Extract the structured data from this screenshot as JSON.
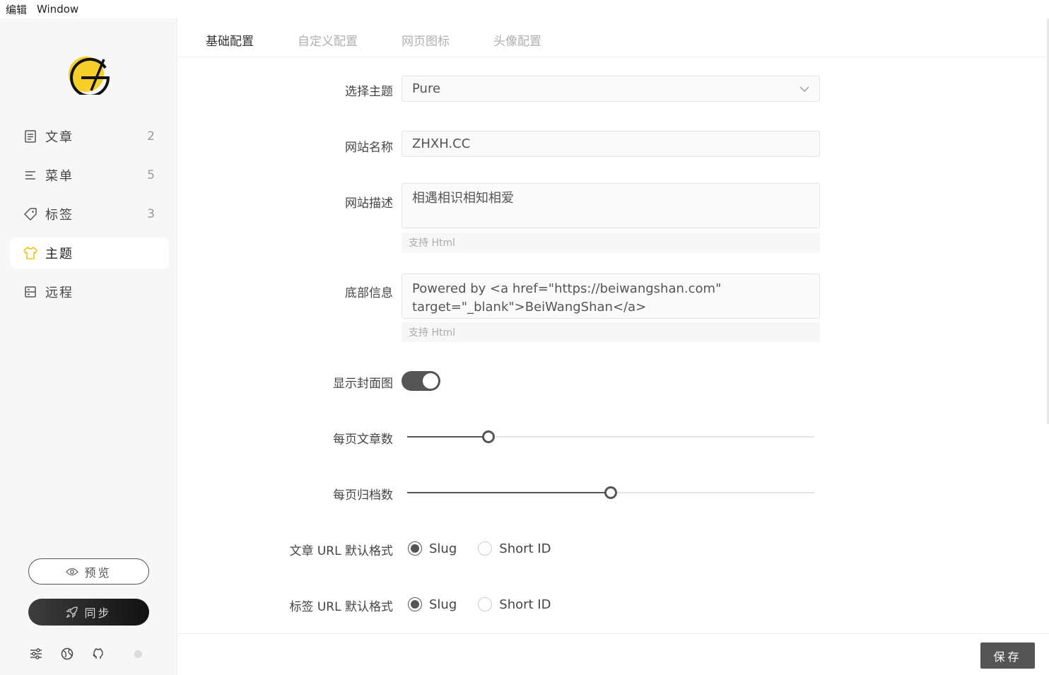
{
  "menubar": {
    "edit": "编辑",
    "window": "Window"
  },
  "sidebar": {
    "items": [
      {
        "label": "文章",
        "count": "2",
        "icon": "article-icon"
      },
      {
        "label": "菜单",
        "count": "5",
        "icon": "menu-icon"
      },
      {
        "label": "标签",
        "count": "3",
        "icon": "tag-icon"
      },
      {
        "label": "主题",
        "count": "",
        "icon": "shirt-icon",
        "active": true
      },
      {
        "label": "远程",
        "count": "",
        "icon": "remote-icon"
      }
    ],
    "preview_label": "预览",
    "sync_label": "同步"
  },
  "tabs": [
    {
      "label": "基础配置",
      "active": true
    },
    {
      "label": "自定义配置"
    },
    {
      "label": "网页图标"
    },
    {
      "label": "头像配置"
    }
  ],
  "form": {
    "theme_label": "选择主题",
    "theme_value": "Pure",
    "site_name_label": "网站名称",
    "site_name_value": "ZHXH.CC",
    "site_desc_label": "网站描述",
    "site_desc_value": "相遇相识相知相爱",
    "site_desc_hint": "支持 Html",
    "footer_label": "底部信息",
    "footer_line1": "Powered by <a href=\"https://beiwangshan.com\"",
    "footer_line2": "target=\"_blank\">BeiWangShan</a>",
    "footer_hint": "支持 Html",
    "show_cover_label": "显示封面图",
    "show_cover_value": true,
    "posts_per_page_label": "每页文章数",
    "posts_per_page_fraction": 0.2,
    "archives_per_page_label": "每页归档数",
    "archives_per_page_fraction": 0.5,
    "post_url_label": "文章 URL 默认格式",
    "tag_url_label": "标签 URL 默认格式",
    "url_options": [
      "Slug",
      "Short ID"
    ],
    "post_url_selected": "Slug",
    "tag_url_selected": "Slug"
  },
  "save_label": "保存",
  "colors": {
    "accent": "#555555",
    "logo_yellow": "#f7cf2b"
  }
}
